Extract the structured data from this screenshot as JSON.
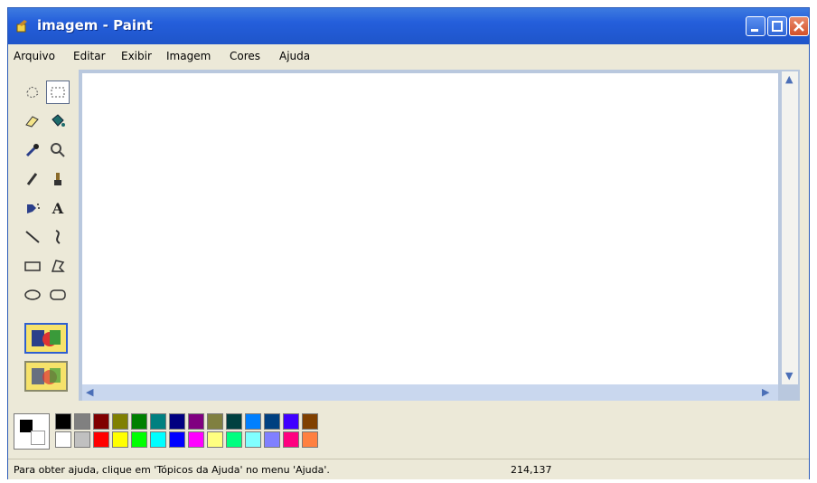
{
  "window": {
    "title": "imagem - Paint"
  },
  "menu": [
    "Arquivo",
    "Editar",
    "Exibir",
    "Imagem",
    "Cores",
    "Ajuda"
  ],
  "tools": [
    {
      "name": "free-select-icon",
      "selected": false
    },
    {
      "name": "rect-select-icon",
      "selected": true
    },
    {
      "name": "eraser-icon",
      "selected": false
    },
    {
      "name": "fill-bucket-icon",
      "selected": false
    },
    {
      "name": "color-picker-icon",
      "selected": false
    },
    {
      "name": "magnifier-icon",
      "selected": false
    },
    {
      "name": "pencil-icon",
      "selected": false
    },
    {
      "name": "brush-icon",
      "selected": false
    },
    {
      "name": "airbrush-icon",
      "selected": false
    },
    {
      "name": "text-icon",
      "selected": false
    },
    {
      "name": "line-icon",
      "selected": false
    },
    {
      "name": "curve-icon",
      "selected": false
    },
    {
      "name": "rectangle-icon",
      "selected": false
    },
    {
      "name": "polygon-icon",
      "selected": false
    },
    {
      "name": "ellipse-icon",
      "selected": false
    },
    {
      "name": "rounded-rect-icon",
      "selected": false
    }
  ],
  "tool_glyphs": {
    "text": "A"
  },
  "palette": {
    "foreground": "#000000",
    "background": "#ffffff",
    "top": [
      "#000000",
      "#808080",
      "#800000",
      "#808000",
      "#008000",
      "#008080",
      "#000080",
      "#800080",
      "#808040",
      "#004040",
      "#0080ff",
      "#004080",
      "#4000ff",
      "#804000"
    ],
    "bottom": [
      "#ffffff",
      "#c0c0c0",
      "#ff0000",
      "#ffff00",
      "#00ff00",
      "#00ffff",
      "#0000ff",
      "#ff00ff",
      "#ffff80",
      "#00ff80",
      "#80ffff",
      "#8080ff",
      "#ff0080",
      "#ff8040"
    ]
  },
  "status": {
    "help_text": "Para obter ajuda, clique em 'Tópicos da Ajuda' no menu 'Ajuda'.",
    "coordinates": "214,137"
  }
}
